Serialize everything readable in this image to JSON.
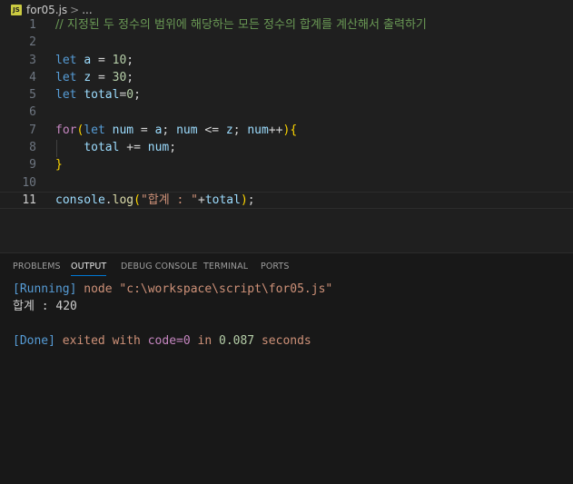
{
  "breadcrumb": {
    "icon_label": "JS",
    "file": "for05.js",
    "separator": ">",
    "tail": "..."
  },
  "editor": {
    "active_line": 11,
    "lines": [
      {
        "n": "1",
        "tokens": [
          {
            "t": "// 지정된 두 정수의 범위에 해당하는 모든 정수의 합계를 계산해서 출력하기",
            "c": "cm"
          }
        ]
      },
      {
        "n": "2",
        "tokens": []
      },
      {
        "n": "3",
        "tokens": [
          {
            "t": "let",
            "c": "kw"
          },
          {
            "t": " ",
            "c": "op"
          },
          {
            "t": "a",
            "c": "var"
          },
          {
            "t": " = ",
            "c": "op"
          },
          {
            "t": "10",
            "c": "num"
          },
          {
            "t": ";",
            "c": "op"
          }
        ]
      },
      {
        "n": "4",
        "tokens": [
          {
            "t": "let",
            "c": "kw"
          },
          {
            "t": " ",
            "c": "op"
          },
          {
            "t": "z",
            "c": "var"
          },
          {
            "t": " = ",
            "c": "op"
          },
          {
            "t": "30",
            "c": "num"
          },
          {
            "t": ";",
            "c": "op"
          }
        ]
      },
      {
        "n": "5",
        "tokens": [
          {
            "t": "let",
            "c": "kw"
          },
          {
            "t": " ",
            "c": "op"
          },
          {
            "t": "total",
            "c": "var"
          },
          {
            "t": "=",
            "c": "op"
          },
          {
            "t": "0",
            "c": "num"
          },
          {
            "t": ";",
            "c": "op"
          }
        ]
      },
      {
        "n": "6",
        "tokens": []
      },
      {
        "n": "7",
        "tokens": [
          {
            "t": "for",
            "c": "ctl"
          },
          {
            "t": "(",
            "c": "br1"
          },
          {
            "t": "let",
            "c": "kw"
          },
          {
            "t": " ",
            "c": "op"
          },
          {
            "t": "num",
            "c": "var"
          },
          {
            "t": " = ",
            "c": "op"
          },
          {
            "t": "a",
            "c": "var"
          },
          {
            "t": "; ",
            "c": "op"
          },
          {
            "t": "num",
            "c": "var"
          },
          {
            "t": " <= ",
            "c": "op"
          },
          {
            "t": "z",
            "c": "var"
          },
          {
            "t": "; ",
            "c": "op"
          },
          {
            "t": "num",
            "c": "var"
          },
          {
            "t": "++",
            "c": "op"
          },
          {
            "t": ")",
            "c": "br1"
          },
          {
            "t": "{",
            "c": "br1"
          }
        ]
      },
      {
        "n": "8",
        "tokens": [
          {
            "t": "    ",
            "c": "op"
          },
          {
            "t": "total",
            "c": "var"
          },
          {
            "t": " += ",
            "c": "op"
          },
          {
            "t": "num",
            "c": "var"
          },
          {
            "t": ";",
            "c": "op"
          }
        ]
      },
      {
        "n": "9",
        "tokens": [
          {
            "t": "}",
            "c": "br1"
          }
        ]
      },
      {
        "n": "10",
        "tokens": []
      },
      {
        "n": "11",
        "tokens": [
          {
            "t": "console",
            "c": "var"
          },
          {
            "t": ".",
            "c": "op"
          },
          {
            "t": "log",
            "c": "fn"
          },
          {
            "t": "(",
            "c": "br1"
          },
          {
            "t": "\"합계 : \"",
            "c": "str"
          },
          {
            "t": "+",
            "c": "op"
          },
          {
            "t": "total",
            "c": "var"
          },
          {
            "t": ")",
            "c": "br1"
          },
          {
            "t": ";",
            "c": "op"
          }
        ]
      }
    ]
  },
  "panel": {
    "tabs": [
      {
        "label": "PROBLEMS",
        "active": false
      },
      {
        "label": "OUTPUT",
        "active": true
      },
      {
        "label": "DEBUG CONSOLE",
        "active": false
      },
      {
        "label": "TERMINAL",
        "active": false
      },
      {
        "label": "PORTS",
        "active": false
      }
    ],
    "output": [
      [
        {
          "t": "[Running]",
          "c": "o-blue"
        },
        {
          "t": " node ",
          "c": "o-str"
        },
        {
          "t": "\"c:\\workspace\\script\\for05.js\"",
          "c": "o-str"
        }
      ],
      [
        {
          "t": "합계 : 420",
          "c": ""
        }
      ],
      [],
      [
        {
          "t": "[Done]",
          "c": "o-blue"
        },
        {
          "t": " exited with ",
          "c": "o-str"
        },
        {
          "t": "code=0",
          "c": "o-purple"
        },
        {
          "t": " in ",
          "c": "o-str"
        },
        {
          "t": "0.087",
          "c": "o-green"
        },
        {
          "t": " seconds",
          "c": "o-str"
        }
      ]
    ]
  },
  "colors": {
    "background": "#1f1f1f",
    "panel_background": "#181818",
    "accent": "#0078d4"
  }
}
